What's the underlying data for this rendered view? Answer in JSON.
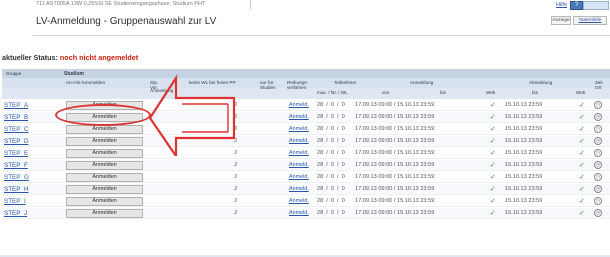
{
  "header": {
    "course_line": "711 AST005A 13W 0,25SSt SE Studieneingangsphase: Studium PHT",
    "title": "LV-Anmeldung - Gruppenauswahl zur LV",
    "help_label": "Hilfe",
    "help_icon": "help-icon",
    "anzeige_label": "Anzeige",
    "tasten_label": "Tastenhilfe"
  },
  "status": {
    "label": "aktueller Status:",
    "value": "noch nicht angemeldet"
  },
  "columns": {
    "gruppe": "Gruppe",
    "studium": "Studium",
    "an_abmelden": "An-/Ab-/Ummelden",
    "stp": "Stp. Vor.",
    "keine_wl": "keine WL bei freien PP",
    "nur_fuer": "nur für Studien",
    "reihungs": "Reihungs- verfahren",
    "teilnehmer": "Teilnehmer",
    "teilnehmer_sub": "max. / fst. / WL",
    "anmeldung": "Anmeldung",
    "anmeldung_von": "von",
    "anmeldung_bis": "bis",
    "web": "Web",
    "abmeldung": "Abmeldung",
    "abmeldung_bis": "bis",
    "zeit": "Zeit Ort",
    "subheader_anmeldung": "Anmeldung"
  },
  "rows": [
    {
      "group": "STEP_A",
      "button": "Anmelden",
      "mark": "J",
      "link": "Anmeld.",
      "cap": "28 / 0 / 0",
      "dates": "17.09.13 09:00 / 15.10.13 23:59",
      "abm": "15.10.13 23:59"
    },
    {
      "group": "STEP_B",
      "button": "Anmelden",
      "mark": "J",
      "link": "Anmeld.",
      "cap": "28 / 0 / 0",
      "dates": "17.09.13 09:00 / 15.10.13 23:59",
      "abm": "15.10.13 23:59"
    },
    {
      "group": "STEP_C",
      "button": "Anmelden",
      "mark": "J",
      "link": "Anmeld.",
      "cap": "28 / 0 / 0",
      "dates": "17.09.13 09:00 / 15.10.13 23:59",
      "abm": "15.10.13 23:59"
    },
    {
      "group": "STEP_D",
      "button": "Anmelden",
      "mark": "J",
      "link": "Anmeld.",
      "cap": "28 / 0 / 0",
      "dates": "17.09.13 09:00 / 15.10.13 23:59",
      "abm": "15.10.13 23:59"
    },
    {
      "group": "STEP_E",
      "button": "Anmelden",
      "mark": "J",
      "link": "Anmeld.",
      "cap": "28 / 0 / 0",
      "dates": "17.09.13 09:00 / 15.10.13 23:59",
      "abm": "15.10.13 23:59"
    },
    {
      "group": "STEP_F",
      "button": "Anmelden",
      "mark": "J",
      "link": "Anmeld.",
      "cap": "28 / 0 / 0",
      "dates": "17.09.13 09:00 / 15.10.13 23:59",
      "abm": "15.10.13 23:59"
    },
    {
      "group": "STEP_G",
      "button": "Anmelden",
      "mark": "J",
      "link": "Anmeld.",
      "cap": "28 / 0 / 0",
      "dates": "17.09.13 09:00 / 15.10.13 23:59",
      "abm": "15.10.13 23:59"
    },
    {
      "group": "STEP_H",
      "button": "Anmelden",
      "mark": "J",
      "link": "Anmeld.",
      "cap": "28 / 0 / 0",
      "dates": "17.09.13 09:00 / 15.10.13 23:59",
      "abm": "15.10.13 23:59"
    },
    {
      "group": "STEP_I",
      "button": "Anmelden",
      "mark": "J",
      "link": "Anmeld.",
      "cap": "28 / 0 / 0",
      "dates": "17.09.13 09:00 / 15.10.13 23:59",
      "abm": "15.10.13 23:59"
    },
    {
      "group": "STEP_J",
      "button": "Anmelden",
      "mark": "J",
      "link": "Anmeld.",
      "cap": "28 / 0 / 0",
      "dates": "17.09.13 09:00 / 15.10.13 23:59",
      "abm": "15.10.13 23:59"
    }
  ],
  "icons": {
    "web_ok": "checkmark-icon",
    "info": "clock-icon"
  },
  "colors": {
    "status_red": "#cc2211",
    "link_blue": "#2857b0",
    "annotation_red": "#dd3333",
    "check_green": "#1e9a1e"
  }
}
